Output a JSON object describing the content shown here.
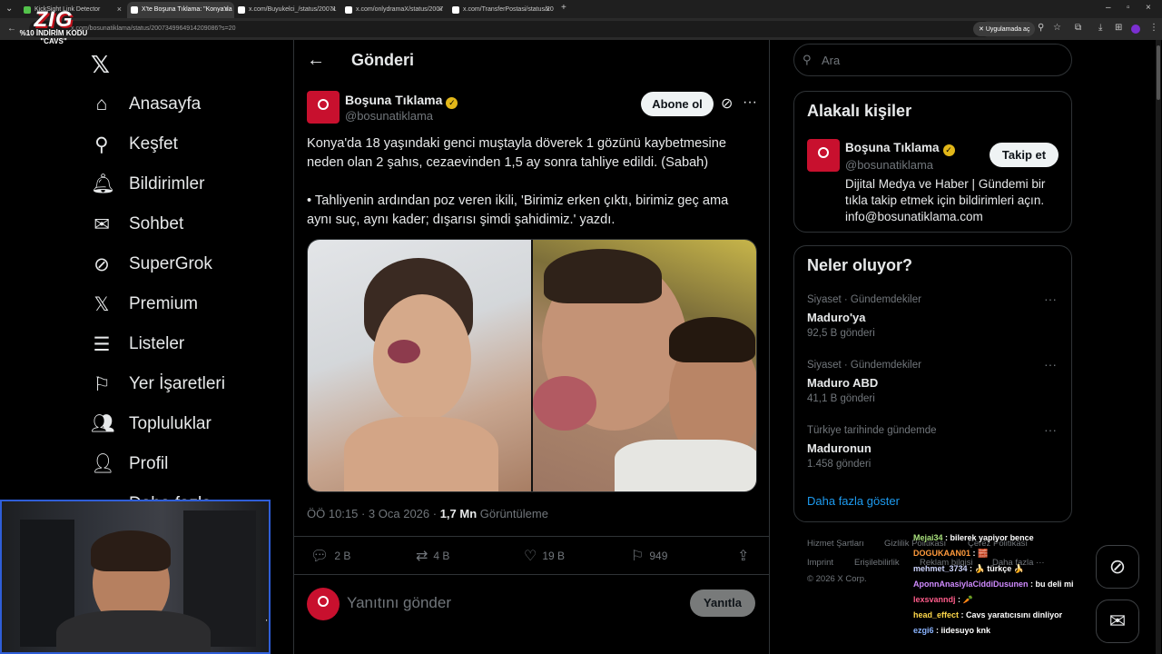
{
  "browser": {
    "tabs": [
      {
        "label": "KickSight Link Detector",
        "active": false
      },
      {
        "label": "X'te Boşuna Tıklama: \"Konya'da",
        "active": true
      },
      {
        "label": "x.com/Buyukelci_/status/20071",
        "active": false
      },
      {
        "label": "x.com/onlydramaX/status/2007",
        "active": false
      },
      {
        "label": "x.com/TransferPostasi/status/20",
        "active": false
      }
    ],
    "url": "x.com/bosunatiklama/status/2007349964914209086?s=20",
    "app_button": "Uygulamada aç"
  },
  "promo": {
    "big": "ZIG",
    "code": "%10 İNDİRİM KODU \"CAVS\""
  },
  "nav": {
    "items": [
      {
        "label": "Anasayfa",
        "icon": "home-icon",
        "glyph": "⌂"
      },
      {
        "label": "Keşfet",
        "icon": "search-icon",
        "glyph": "⚲"
      },
      {
        "label": "Bildirimler",
        "icon": "bell-icon",
        "glyph": "🔔︎"
      },
      {
        "label": "Sohbet",
        "icon": "mail-icon",
        "glyph": "✉"
      },
      {
        "label": "SuperGrok",
        "icon": "grok-icon",
        "glyph": "⊘"
      },
      {
        "label": "Premium",
        "icon": "x-icon",
        "glyph": "𝕏"
      },
      {
        "label": "Listeler",
        "icon": "list-icon",
        "glyph": "☰"
      },
      {
        "label": "Yer İşaretleri",
        "icon": "bookmark-icon",
        "glyph": "⚐"
      },
      {
        "label": "Topluluklar",
        "icon": "community-icon",
        "glyph": "👥︎"
      },
      {
        "label": "Profil",
        "icon": "profile-icon",
        "glyph": "👤︎"
      },
      {
        "label": "Daha fazla",
        "icon": "more-icon",
        "glyph": "⋯"
      }
    ]
  },
  "post": {
    "header_title": "Gönderi",
    "author_name": "Boşuna Tıklama",
    "author_handle": "@bosunatiklama",
    "subscribe_label": "Abone ol",
    "text1": "Konya'da 18 yaşındaki genci muştayla döverek 1 gözünü kaybetmesine neden olan 2 şahıs, cezaevinden 1,5 ay sonra tahliye edildi. (Sabah)",
    "text2": "• Tahliyenin ardından poz veren ikili, 'Birimiz erken çıktı, birimiz geç ama aynı suç, aynı kader; dışarısı şimdi şahidimiz.' yazdı.",
    "time": "ÖÖ 10:15 · 3 Oca 2026 · ",
    "views": "1,7 Mn",
    "views_label": " Görüntüleme",
    "actions": {
      "replies": "2 B",
      "reposts": "4 B",
      "likes": "19 B",
      "bookmarks": "949"
    },
    "reply_placeholder": "Yanıtını gönder",
    "reply_button": "Yanıtla"
  },
  "sidebar": {
    "search_placeholder": "Ara",
    "related_title": "Alakalı kişiler",
    "related": {
      "name": "Boşuna Tıklama",
      "handle": "@bosunatiklama",
      "follow_label": "Takip et",
      "bio": "Dijital Medya ve Haber | Gündemi bir tıkla takip etmek için bildirimleri açın. info@bosunatiklama.com"
    },
    "trends_title": "Neler oluyor?",
    "trends": [
      {
        "context": "Siyaset · Gündemdekiler",
        "title": "Maduro'ya",
        "count": "92,5 B gönderi"
      },
      {
        "context": "Siyaset · Gündemdekiler",
        "title": "Maduro ABD",
        "count": "41,1 B gönderi"
      },
      {
        "context": "Türkiye tarihinde gündemde",
        "title": "Maduronun",
        "count": "1.458 gönderi"
      }
    ],
    "show_more": "Daha fazla göster",
    "footer": {
      "terms": "Hizmet Şartları",
      "privacy": "Gizlilik Politikası",
      "cookies": "Çerez Politikası",
      "imprint": "Imprint",
      "accessibility": "Erişilebilirlik",
      "ads": "Reklam bilgisi",
      "more": "Daha fazla ···",
      "copyright": "© 2026 X Corp."
    }
  },
  "chat": [
    {
      "user": "Mejai34",
      "color": "#a8e07c",
      "msg": "bilerek yapiyor bence"
    },
    {
      "user": "DOGUKAAN01",
      "color": "#ff9a3c",
      "msg": "🧱"
    },
    {
      "user": "mehmet_3734",
      "color": "#cfd6ff",
      "msg": "🍌 türkçe 🍌"
    },
    {
      "user": "AponnAnasiylaCiddiDusunen",
      "color": "#d08bff",
      "msg": "bu deli mi"
    },
    {
      "user": "lexsvanndj",
      "color": "#ff5c8a",
      "msg": "🥕"
    },
    {
      "user": "head_effect",
      "color": "#ffd84a",
      "msg": "Cavs yaratıcısını dinliyor"
    },
    {
      "user": "ezgi6",
      "color": "#8ab4ff",
      "msg": "iidesuyo knk"
    }
  ]
}
